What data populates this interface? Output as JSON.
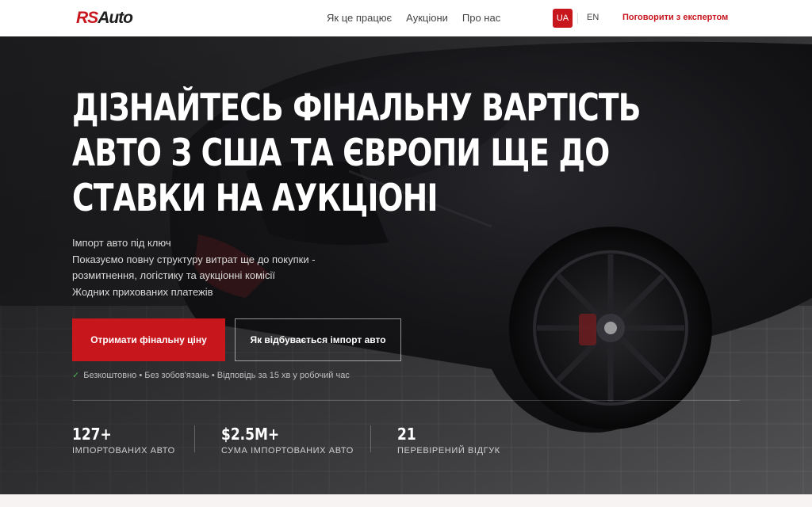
{
  "header": {
    "logo_rs": "RS",
    "logo_auto": "Auto",
    "nav": [
      "Як це працює",
      "Аукціони",
      "Про нас"
    ],
    "lang_ua": "UA",
    "lang_en": "EN",
    "cta": "Поговорити з експертом"
  },
  "hero": {
    "title_lines": [
      "ДІЗНАЙТЕСЬ ФІНАЛЬНУ ВАРТІСТЬ",
      "АВТО З США ТА ЄВРОПИ ЩЕ ДО",
      "СТАВКИ НА АУКЦІОНІ"
    ],
    "subtitle_lines": [
      "Імпорт авто під ключ",
      "Показуємо повну структуру витрат ще до покупки -",
      "розмитнення, логістику та аукціонні комісії",
      "Жодних прихованих платежів"
    ],
    "primary_button": "Отримати фінальну ціну",
    "secondary_button": "Як відбувається імпорт авто",
    "trust_text": "Безкоштовно • Без зобов'язань • Відповідь за 15 хв у робочий час"
  },
  "stats": [
    {
      "value": "127+",
      "label": "ІМПОРТОВАНИХ АВТО"
    },
    {
      "value": "$2.5M+",
      "label": "СУМА ІМПОРТОВАНИХ АВТО"
    },
    {
      "value": "21",
      "label": "ПЕРЕВІРЕНИЙ ВІДГУК"
    }
  ],
  "colors": {
    "brand_red": "#c8161d",
    "check_green": "#4caf50"
  },
  "icons": [
    "check-icon"
  ]
}
